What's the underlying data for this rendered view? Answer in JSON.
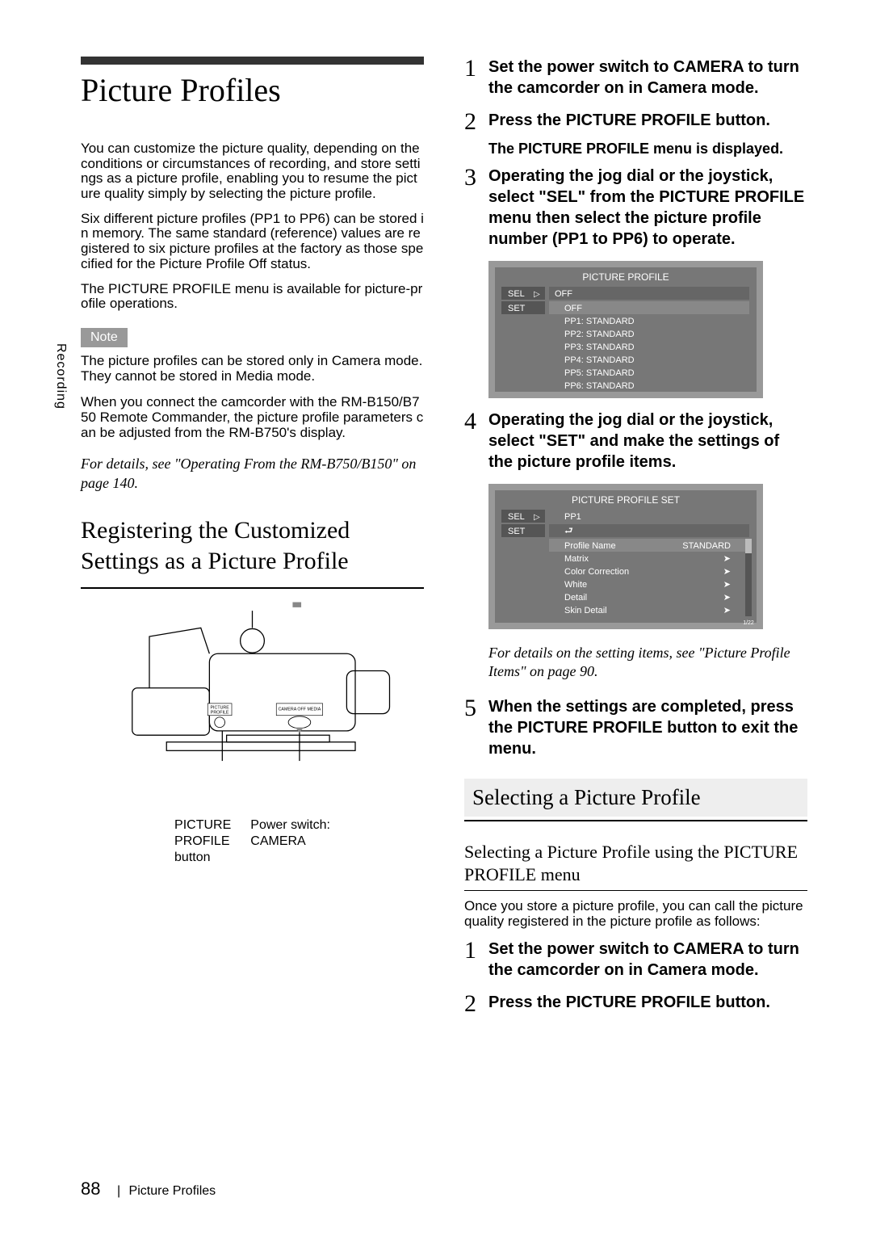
{
  "sideTab": "Recording",
  "title": "Picture Profiles",
  "para1": "You can customize the picture quality, depending on the conditions or circumstances of recording, and store settings as a picture profile, enabling you to resume the picture quality simply by selecting the picture profile.",
  "para2": "Six different picture profiles (PP1 to PP6) can be stored in memory. The same standard (reference) values are registered to six picture profiles at the factory as those specified for the Picture Profile Off status.",
  "para3": "The PICTURE PROFILE menu is available for picture-profile operations.",
  "noteLabel": "Note",
  "noteText": "The picture profiles can be stored only in Camera mode. They cannot be stored in Media mode.",
  "para4": "When you connect the camcorder with the RM-B150/B750 Remote Commander, the picture profile parameters can be adjusted from the RM-B750's display.",
  "ref1": "For details, see \"Operating From the RM-B750/B150\" on page 140.",
  "sectionA": "Registering the Customized Settings as a Picture Profile",
  "camLabelLeft1": "PICTURE",
  "camLabelLeft2": "PROFILE",
  "camLabelLeft3": "button",
  "camLabelRight1": "Power switch:",
  "camLabelRight2": "CAMERA",
  "chipTop": "PICTURE\nPROFILE",
  "chipRight": "CAMERA OFF MEDIA",
  "stepsA": [
    {
      "n": "1",
      "t": "Set the power switch to CAMERA to turn the camcorder on in Camera mode."
    },
    {
      "n": "2",
      "t": "Press the PICTURE PROFILE button."
    },
    {
      "n": "3",
      "t": "Operating the jog dial or the joystick, select \"SEL\" from the PICTURE PROFILE menu then select the picture profile number (PP1 to PP6) to operate."
    },
    {
      "n": "4",
      "t": "Operating the jog dial or the joystick, select \"SET\" and make the settings of the picture profile items."
    },
    {
      "n": "5",
      "t": "When the settings are completed, press the PICTURE PROFILE button to exit the menu."
    }
  ],
  "step2sub": "The PICTURE PROFILE menu is displayed.",
  "menu1": {
    "title": "PICTURE PROFILE",
    "sel": "SEL",
    "selVal": "OFF",
    "set": "SET",
    "options": [
      "OFF",
      "PP1: STANDARD",
      "PP2: STANDARD",
      "PP3: STANDARD",
      "PP4: STANDARD",
      "PP5: STANDARD",
      "PP6: STANDARD"
    ]
  },
  "menu2": {
    "title": "PICTURE PROFILE SET",
    "sel": "SEL",
    "selVal": "PP1",
    "set": "SET",
    "back": "⮐",
    "items": [
      {
        "k": "Profile Name",
        "v": "STANDARD"
      },
      {
        "k": "Matrix",
        "v": "➤"
      },
      {
        "k": "Color Correction",
        "v": "➤"
      },
      {
        "k": "White",
        "v": "➤"
      },
      {
        "k": "Detail",
        "v": "➤"
      },
      {
        "k": "Skin Detail",
        "v": "➤"
      }
    ],
    "scroll": "1/22"
  },
  "ref2": "For details on the setting items, see \"Picture Profile Items\" on page 90.",
  "sectionB": "Selecting a Picture Profile",
  "subHeadingB": "Selecting a Picture Profile using the PICTURE PROFILE menu",
  "paraB": "Once you store a picture profile, you can call the picture quality registered in the picture profile as follows:",
  "stepsB": [
    {
      "n": "1",
      "t": "Set the power switch to CAMERA to turn the camcorder on in Camera mode."
    },
    {
      "n": "2",
      "t": "Press the PICTURE PROFILE button."
    }
  ],
  "footerPage": "88",
  "footerTitle": "Picture Profiles"
}
